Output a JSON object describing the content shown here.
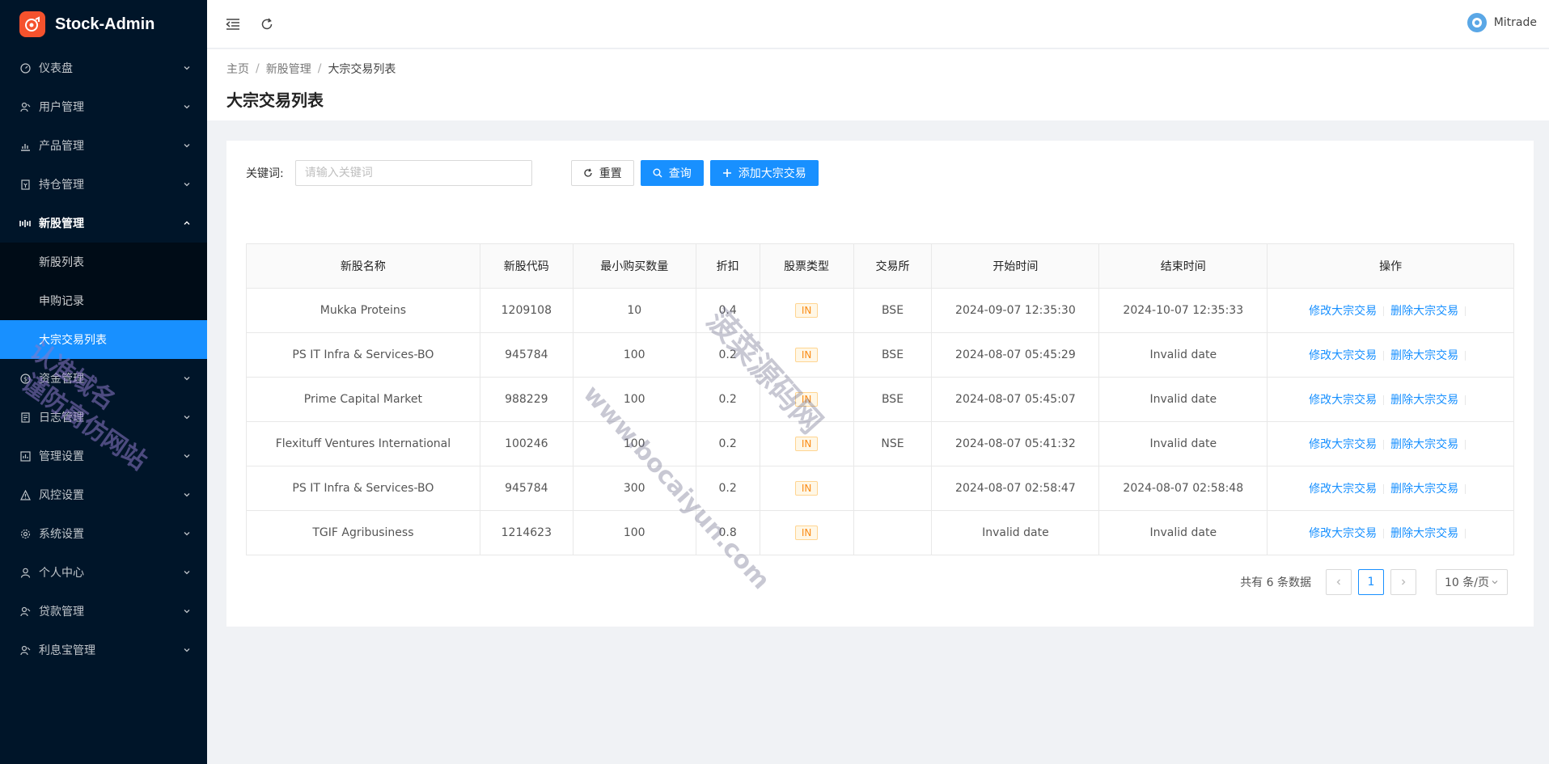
{
  "app": {
    "title": "Stock-Admin"
  },
  "sidebar": {
    "items": [
      {
        "label": "仪表盘",
        "icon": "dashboard-icon"
      },
      {
        "label": "用户管理",
        "icon": "users-icon"
      },
      {
        "label": "产品管理",
        "icon": "chart-icon"
      },
      {
        "label": "持仓管理",
        "icon": "position-icon"
      },
      {
        "label": "新股管理",
        "icon": "ipo-icon"
      },
      {
        "label": "资金管理",
        "icon": "money-icon"
      },
      {
        "label": "日志管理",
        "icon": "log-icon"
      },
      {
        "label": "管理设置",
        "icon": "admin-settings-icon"
      },
      {
        "label": "风控设置",
        "icon": "warning-icon"
      },
      {
        "label": "系统设置",
        "icon": "gear-icon"
      },
      {
        "label": "个人中心",
        "icon": "person-icon"
      },
      {
        "label": "贷款管理",
        "icon": "loan-icon"
      },
      {
        "label": "利息宝管理",
        "icon": "interest-icon"
      }
    ],
    "submenu": [
      {
        "label": "新股列表"
      },
      {
        "label": "申购记录"
      },
      {
        "label": "大宗交易列表"
      }
    ]
  },
  "header": {
    "user_name": "Mitrade"
  },
  "breadcrumb": {
    "home": "主页",
    "section": "新股管理",
    "current": "大宗交易列表",
    "sep": "/"
  },
  "page": {
    "title": "大宗交易列表"
  },
  "filter": {
    "keyword_label": "关键词:",
    "keyword_placeholder": "请输入关键词",
    "keyword_value": "",
    "reset_label": "重置",
    "query_label": "查询",
    "add_label": "添加大宗交易"
  },
  "table": {
    "columns": [
      "新股名称",
      "新股代码",
      "最小购买数量",
      "折扣",
      "股票类型",
      "交易所",
      "开始时间",
      "结束时间",
      "操作"
    ],
    "rows": [
      {
        "name": "Mukka Proteins",
        "code": "1209108",
        "min_qty": "10",
        "discount": "0.4",
        "type": "IN",
        "exchange": "BSE",
        "start": "2024-09-07 12:35:30",
        "end": "2024-10-07 12:35:33"
      },
      {
        "name": "PS IT Infra & Services-BO",
        "code": "945784",
        "min_qty": "100",
        "discount": "0.2",
        "type": "IN",
        "exchange": "BSE",
        "start": "2024-08-07 05:45:29",
        "end": "Invalid date"
      },
      {
        "name": "Prime Capital Market",
        "code": "988229",
        "min_qty": "100",
        "discount": "0.2",
        "type": "IN",
        "exchange": "BSE",
        "start": "2024-08-07 05:45:07",
        "end": "Invalid date"
      },
      {
        "name": "Flexituff Ventures International",
        "code": "100246",
        "min_qty": "100",
        "discount": "0.2",
        "type": "IN",
        "exchange": "NSE",
        "start": "2024-08-07 05:41:32",
        "end": "Invalid date"
      },
      {
        "name": "PS IT Infra & Services-BO",
        "code": "945784",
        "min_qty": "300",
        "discount": "0.2",
        "type": "IN",
        "exchange": "",
        "start": "2024-08-07 02:58:47",
        "end": "2024-08-07 02:58:48"
      },
      {
        "name": "TGIF Agribusiness",
        "code": "1214623",
        "min_qty": "100",
        "discount": "0.8",
        "type": "IN",
        "exchange": "",
        "start": "Invalid date",
        "end": "Invalid date"
      }
    ],
    "edit_label": "修改大宗交易",
    "delete_label": "删除大宗交易"
  },
  "pagination": {
    "total_text": "共有 6 条数据",
    "current_page": "1",
    "page_size": "10 条/页"
  },
  "watermarks": [
    "www.bocaiyun.com",
    "菠菜源码网",
    "认准域名",
    "谨防高仿网站"
  ]
}
